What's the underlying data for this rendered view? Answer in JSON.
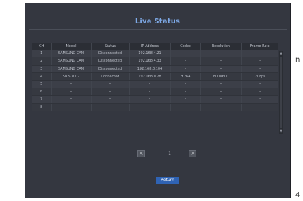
{
  "edge_marks": [
    "n",
    "4"
  ],
  "dialog": {
    "title": "Live Status",
    "columns": [
      "CH",
      "Model",
      "Status",
      "IP Address",
      "Codec",
      "Resolution",
      "Frame Rate"
    ],
    "rows": [
      [
        "1",
        "SAMSUNG CAM",
        "Disconnected",
        "192.168.4.21",
        "–",
        "–",
        "–"
      ],
      [
        "2",
        "SAMSUNG CAM",
        "Disconnected",
        "192.168.4.33",
        "–",
        "–",
        "–"
      ],
      [
        "3",
        "SAMSUNG CAM",
        "Disconnected",
        "192.168.0.104",
        "–",
        "–",
        "–"
      ],
      [
        "4",
        "SNB-7002",
        "Connected",
        "192.168.0.28",
        "H.264",
        "800X600",
        "20Fps"
      ],
      [
        "5",
        "–",
        "–",
        "–",
        "–",
        "–",
        "–"
      ],
      [
        "6",
        "–",
        "–",
        "–",
        "–",
        "–",
        "–"
      ],
      [
        "7",
        "–",
        "–",
        "–",
        "–",
        "–",
        "–"
      ],
      [
        "8",
        "–",
        "–",
        "–",
        "–",
        "–",
        "–"
      ]
    ],
    "pager": {
      "prev": "<",
      "page": "1",
      "next": ">"
    },
    "return_label": "Return"
  },
  "colors": {
    "dialog_bg": "#343740",
    "title": "#7ea9e6",
    "button_accent": "#2f63b4"
  }
}
